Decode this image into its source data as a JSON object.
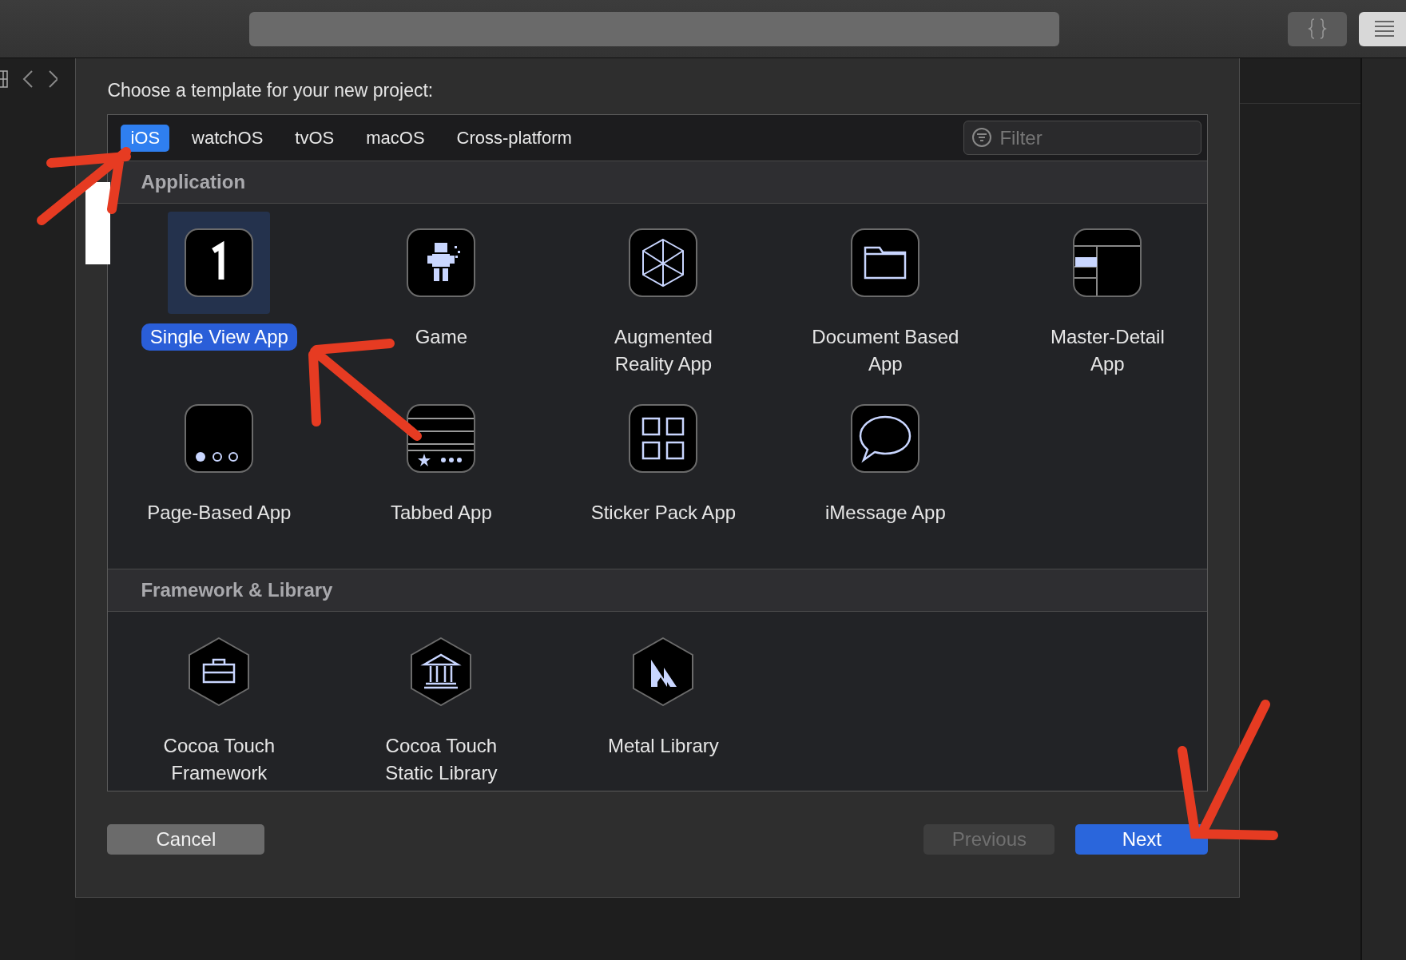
{
  "dialog": {
    "title": "Choose a template for your new project:",
    "tabs": [
      {
        "label": "iOS",
        "selected": true
      },
      {
        "label": "watchOS",
        "selected": false
      },
      {
        "label": "tvOS",
        "selected": false
      },
      {
        "label": "macOS",
        "selected": false
      },
      {
        "label": "Cross-platform",
        "selected": false
      }
    ],
    "filter": {
      "placeholder": "Filter"
    },
    "sections": [
      {
        "title": "Application",
        "templates": [
          {
            "label": "Single View App",
            "kind": "single",
            "selected": true
          },
          {
            "label": "Game",
            "kind": "game",
            "selected": false
          },
          {
            "label": "Augmented Reality App",
            "kind": "ar",
            "selected": false
          },
          {
            "label": "Document Based App",
            "kind": "document",
            "selected": false
          },
          {
            "label": "Master-Detail App",
            "kind": "master",
            "selected": false
          },
          {
            "label": "Page-Based App",
            "kind": "page",
            "selected": false
          },
          {
            "label": "Tabbed App",
            "kind": "tabbed",
            "selected": false
          },
          {
            "label": "Sticker Pack App",
            "kind": "sticker",
            "selected": false
          },
          {
            "label": "iMessage App",
            "kind": "imessage",
            "selected": false
          }
        ]
      },
      {
        "title": "Framework & Library",
        "templates": [
          {
            "label": "Cocoa Touch Framework",
            "kind": "framework",
            "selected": false
          },
          {
            "label": "Cocoa Touch Static Library",
            "kind": "static",
            "selected": false
          },
          {
            "label": "Metal Library",
            "kind": "metal",
            "selected": false
          }
        ]
      }
    ],
    "buttons": [
      {
        "label": "Cancel",
        "kind": "cancel",
        "disabled": false
      },
      {
        "label": "Previous",
        "kind": "previous",
        "disabled": true
      },
      {
        "label": "Next",
        "kind": "next",
        "disabled": false
      }
    ]
  }
}
